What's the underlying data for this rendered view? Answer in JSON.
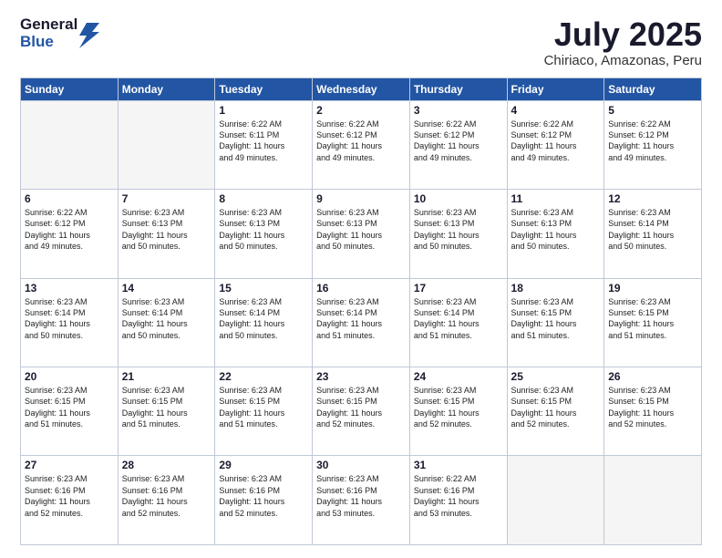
{
  "logo": {
    "general": "General",
    "blue": "Blue"
  },
  "header": {
    "month": "July 2025",
    "location": "Chiriaco, Amazonas, Peru"
  },
  "weekdays": [
    "Sunday",
    "Monday",
    "Tuesday",
    "Wednesday",
    "Thursday",
    "Friday",
    "Saturday"
  ],
  "weeks": [
    [
      {
        "day": "",
        "info": ""
      },
      {
        "day": "",
        "info": ""
      },
      {
        "day": "1",
        "info": "Sunrise: 6:22 AM\nSunset: 6:11 PM\nDaylight: 11 hours\nand 49 minutes."
      },
      {
        "day": "2",
        "info": "Sunrise: 6:22 AM\nSunset: 6:12 PM\nDaylight: 11 hours\nand 49 minutes."
      },
      {
        "day": "3",
        "info": "Sunrise: 6:22 AM\nSunset: 6:12 PM\nDaylight: 11 hours\nand 49 minutes."
      },
      {
        "day": "4",
        "info": "Sunrise: 6:22 AM\nSunset: 6:12 PM\nDaylight: 11 hours\nand 49 minutes."
      },
      {
        "day": "5",
        "info": "Sunrise: 6:22 AM\nSunset: 6:12 PM\nDaylight: 11 hours\nand 49 minutes."
      }
    ],
    [
      {
        "day": "6",
        "info": "Sunrise: 6:22 AM\nSunset: 6:12 PM\nDaylight: 11 hours\nand 49 minutes."
      },
      {
        "day": "7",
        "info": "Sunrise: 6:23 AM\nSunset: 6:13 PM\nDaylight: 11 hours\nand 50 minutes."
      },
      {
        "day": "8",
        "info": "Sunrise: 6:23 AM\nSunset: 6:13 PM\nDaylight: 11 hours\nand 50 minutes."
      },
      {
        "day": "9",
        "info": "Sunrise: 6:23 AM\nSunset: 6:13 PM\nDaylight: 11 hours\nand 50 minutes."
      },
      {
        "day": "10",
        "info": "Sunrise: 6:23 AM\nSunset: 6:13 PM\nDaylight: 11 hours\nand 50 minutes."
      },
      {
        "day": "11",
        "info": "Sunrise: 6:23 AM\nSunset: 6:13 PM\nDaylight: 11 hours\nand 50 minutes."
      },
      {
        "day": "12",
        "info": "Sunrise: 6:23 AM\nSunset: 6:14 PM\nDaylight: 11 hours\nand 50 minutes."
      }
    ],
    [
      {
        "day": "13",
        "info": "Sunrise: 6:23 AM\nSunset: 6:14 PM\nDaylight: 11 hours\nand 50 minutes."
      },
      {
        "day": "14",
        "info": "Sunrise: 6:23 AM\nSunset: 6:14 PM\nDaylight: 11 hours\nand 50 minutes."
      },
      {
        "day": "15",
        "info": "Sunrise: 6:23 AM\nSunset: 6:14 PM\nDaylight: 11 hours\nand 50 minutes."
      },
      {
        "day": "16",
        "info": "Sunrise: 6:23 AM\nSunset: 6:14 PM\nDaylight: 11 hours\nand 51 minutes."
      },
      {
        "day": "17",
        "info": "Sunrise: 6:23 AM\nSunset: 6:14 PM\nDaylight: 11 hours\nand 51 minutes."
      },
      {
        "day": "18",
        "info": "Sunrise: 6:23 AM\nSunset: 6:15 PM\nDaylight: 11 hours\nand 51 minutes."
      },
      {
        "day": "19",
        "info": "Sunrise: 6:23 AM\nSunset: 6:15 PM\nDaylight: 11 hours\nand 51 minutes."
      }
    ],
    [
      {
        "day": "20",
        "info": "Sunrise: 6:23 AM\nSunset: 6:15 PM\nDaylight: 11 hours\nand 51 minutes."
      },
      {
        "day": "21",
        "info": "Sunrise: 6:23 AM\nSunset: 6:15 PM\nDaylight: 11 hours\nand 51 minutes."
      },
      {
        "day": "22",
        "info": "Sunrise: 6:23 AM\nSunset: 6:15 PM\nDaylight: 11 hours\nand 51 minutes."
      },
      {
        "day": "23",
        "info": "Sunrise: 6:23 AM\nSunset: 6:15 PM\nDaylight: 11 hours\nand 52 minutes."
      },
      {
        "day": "24",
        "info": "Sunrise: 6:23 AM\nSunset: 6:15 PM\nDaylight: 11 hours\nand 52 minutes."
      },
      {
        "day": "25",
        "info": "Sunrise: 6:23 AM\nSunset: 6:15 PM\nDaylight: 11 hours\nand 52 minutes."
      },
      {
        "day": "26",
        "info": "Sunrise: 6:23 AM\nSunset: 6:15 PM\nDaylight: 11 hours\nand 52 minutes."
      }
    ],
    [
      {
        "day": "27",
        "info": "Sunrise: 6:23 AM\nSunset: 6:16 PM\nDaylight: 11 hours\nand 52 minutes."
      },
      {
        "day": "28",
        "info": "Sunrise: 6:23 AM\nSunset: 6:16 PM\nDaylight: 11 hours\nand 52 minutes."
      },
      {
        "day": "29",
        "info": "Sunrise: 6:23 AM\nSunset: 6:16 PM\nDaylight: 11 hours\nand 52 minutes."
      },
      {
        "day": "30",
        "info": "Sunrise: 6:23 AM\nSunset: 6:16 PM\nDaylight: 11 hours\nand 53 minutes."
      },
      {
        "day": "31",
        "info": "Sunrise: 6:22 AM\nSunset: 6:16 PM\nDaylight: 11 hours\nand 53 minutes."
      },
      {
        "day": "",
        "info": ""
      },
      {
        "day": "",
        "info": ""
      }
    ]
  ]
}
